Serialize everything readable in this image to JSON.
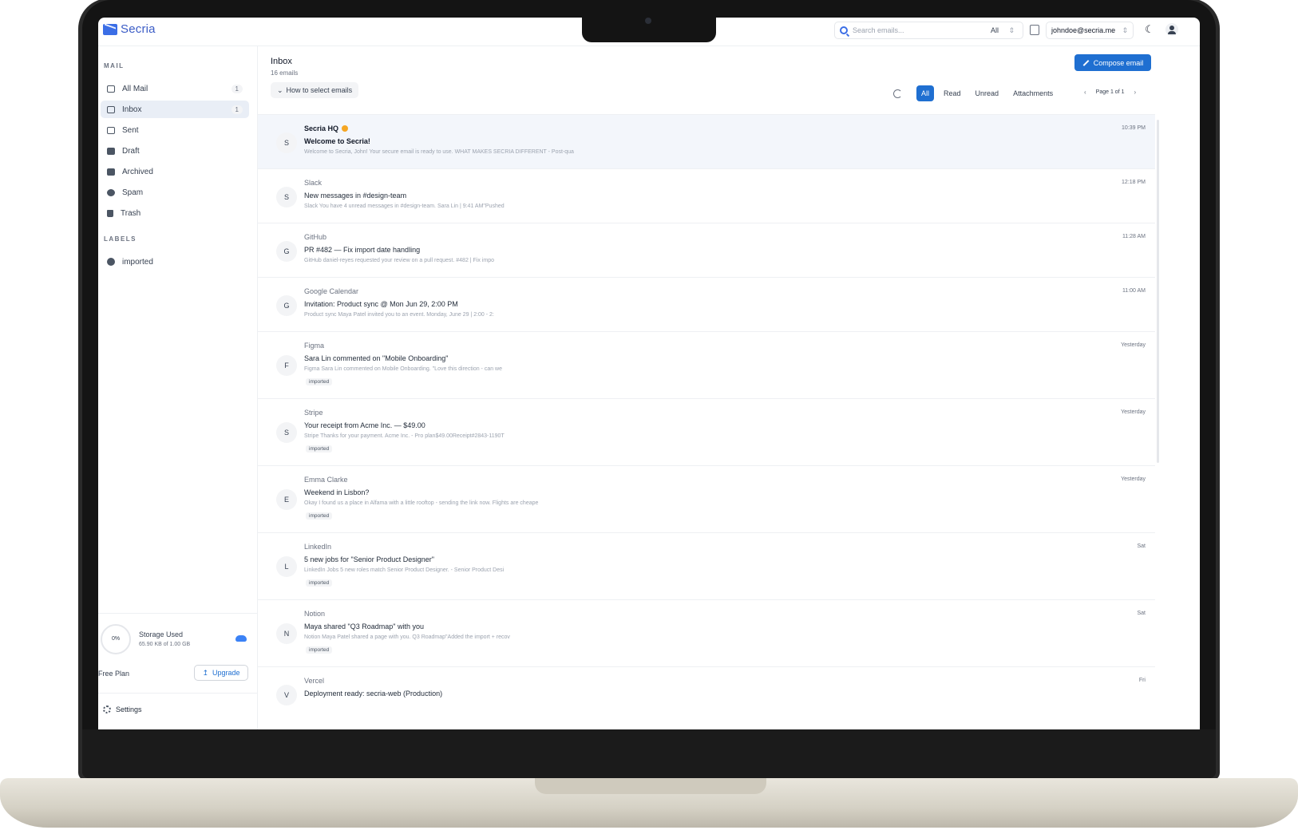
{
  "brand": {
    "name": "Secria"
  },
  "search": {
    "placeholder": "Search emails...",
    "scope": "All"
  },
  "account": {
    "email": "johndoe@secria.me"
  },
  "sidebar": {
    "mail_label": "MAIL",
    "labels_label": "LABELS",
    "items": [
      {
        "label": "All Mail",
        "count": "1"
      },
      {
        "label": "Inbox",
        "count": "1"
      },
      {
        "label": "Sent"
      },
      {
        "label": "Draft"
      },
      {
        "label": "Archived"
      },
      {
        "label": "Spam"
      },
      {
        "label": "Trash"
      }
    ],
    "labels": [
      {
        "label": "imported"
      }
    ],
    "storage": {
      "percent": "0%",
      "title": "Storage Used",
      "usage": "65.90 KB of 1.00 GB"
    },
    "plan": "Free Plan",
    "upgrade": "Upgrade",
    "settings": "Settings"
  },
  "main": {
    "title": "Inbox",
    "count": "16 emails",
    "howto": "How to select emails",
    "compose": "Compose email",
    "filters": [
      "All",
      "Read",
      "Unread",
      "Attachments"
    ],
    "page": "Page 1 of 1"
  },
  "emails": [
    {
      "avatar": "S",
      "sender": "Secria HQ",
      "subject": "Welcome to Secria!",
      "preview": "Welcome to Secria, John! Your secure email is ready to use. WHAT MAKES SECRIA DIFFERENT - Post-qua",
      "time": "10:39 PM",
      "unread": true,
      "verified": true
    },
    {
      "avatar": "S",
      "sender": "Slack",
      "subject": "New messages in #design-team",
      "preview": "Slack You have 4 unread messages in #design-team. Sara Lin | 9:41 AM\"Pushed",
      "time": "12:18 PM"
    },
    {
      "avatar": "G",
      "sender": "GitHub",
      "subject": "PR #482 — Fix import date handling",
      "preview": "GitHub daniel-reyes requested your review on a pull request. #482 | Fix impo",
      "time": "11:28 AM"
    },
    {
      "avatar": "G",
      "sender": "Google Calendar",
      "subject": "Invitation: Product sync @ Mon Jun 29, 2:00 PM",
      "preview": "Product sync Maya Patel invited you to an event. Monday, June 29 | 2:00 - 2:",
      "time": "11:00 AM"
    },
    {
      "avatar": "F",
      "sender": "Figma",
      "subject": "Sara Lin commented on \"Mobile Onboarding\"",
      "preview": "Figma Sara Lin commented on Mobile Onboarding. \"Love this direction - can we",
      "time": "Yesterday",
      "tag": "imported"
    },
    {
      "avatar": "S",
      "sender": "Stripe",
      "subject": "Your receipt from Acme Inc. — $49.00",
      "preview": "Stripe Thanks for your payment. Acme Inc. - Pro plan$49.00Receipt#2843-1190T",
      "time": "Yesterday",
      "tag": "imported"
    },
    {
      "avatar": "E",
      "sender": "Emma Clarke",
      "subject": "Weekend in Lisbon?",
      "preview": "Okay I found us a place in Alfama with a little rooftop - sending the link now. Flights are cheape",
      "time": "Yesterday",
      "tag": "imported"
    },
    {
      "avatar": "L",
      "sender": "LinkedIn",
      "subject": "5 new jobs for \"Senior Product Designer\"",
      "preview": "LinkedIn Jobs 5 new roles match Senior Product Designer. - Senior Product Desi",
      "time": "Sat",
      "tag": "imported"
    },
    {
      "avatar": "N",
      "sender": "Notion",
      "subject": "Maya shared \"Q3 Roadmap\" with you",
      "preview": "Notion Maya Patel shared a page with you. Q3 Roadmap\"Added the import + recov",
      "time": "Sat",
      "tag": "imported"
    },
    {
      "avatar": "V",
      "sender": "Vercel",
      "subject": "Deployment ready: secria-web (Production)",
      "preview": "",
      "time": "Fri"
    }
  ]
}
